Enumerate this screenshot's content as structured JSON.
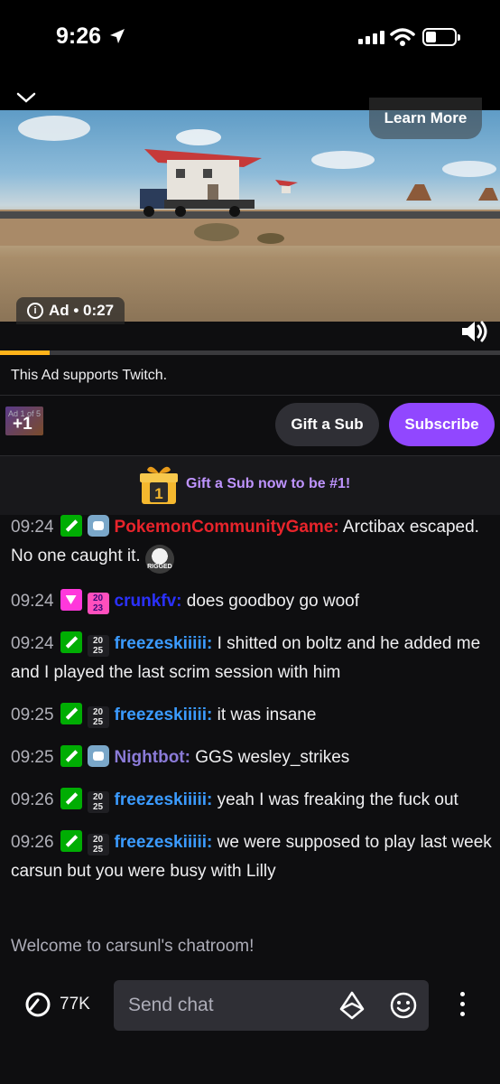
{
  "status_bar": {
    "time": "9:26"
  },
  "ad": {
    "learn_more": "Learn More",
    "label": "Ad • 0:27",
    "progress": 0.1,
    "supports_text": "This Ad supports Twitch.",
    "thumb_label": "+1",
    "thumb_count": "Ad 1 of 5"
  },
  "actions": {
    "gift_label": "Gift a Sub",
    "subscribe_label": "Subscribe"
  },
  "gift_banner": {
    "box_number": "1",
    "text": "Gift a Sub now to be #1!"
  },
  "chat": {
    "messages": [
      {
        "time": "09:24",
        "badges": [
          "sword-badge",
          "bot-badge"
        ],
        "user": "PokemonCommunityGame:",
        "user_color": "#e8242b",
        "text": " Arctibax escaped. No one caught it. ",
        "emote": "RIGGED"
      },
      {
        "time": "09:24",
        "badges": [
          "gem-badge",
          "2023-badge"
        ],
        "user": "crunkfv:",
        "user_color": "#2b31ff",
        "text": " does goodboy go woof"
      },
      {
        "time": "09:24",
        "badges": [
          "sword-badge",
          "2025-badge"
        ],
        "user": "freezeskiiiii:",
        "user_color": "#3b9bff",
        "text": " I shitted on boltz and he added me and I played the last scrim session with him"
      },
      {
        "time": "09:25",
        "badges": [
          "sword-badge",
          "2025-badge"
        ],
        "user": "freezeskiiiii:",
        "user_color": "#3b9bff",
        "text": " it was insane"
      },
      {
        "time": "09:25",
        "badges": [
          "sword-badge",
          "bot-badge"
        ],
        "user": "Nightbot:",
        "user_color": "#8b7bd8",
        "text": " GGS wesley_strikes"
      },
      {
        "time": "09:26",
        "badges": [
          "sword-badge",
          "2025-badge"
        ],
        "user": "freezeskiiiii:",
        "user_color": "#3b9bff",
        "text": " yeah I was freaking the fuck out"
      },
      {
        "time": "09:26",
        "badges": [
          "sword-badge",
          "2025-badge"
        ],
        "user": "freezeskiiiii:",
        "user_color": "#3b9bff",
        "text": " we were supposed to play last week carsun but you were busy with Lilly"
      }
    ],
    "welcome": "Welcome to carsunl's chatroom!"
  },
  "bottom": {
    "viewers": "77K",
    "input_placeholder": "Send chat"
  }
}
